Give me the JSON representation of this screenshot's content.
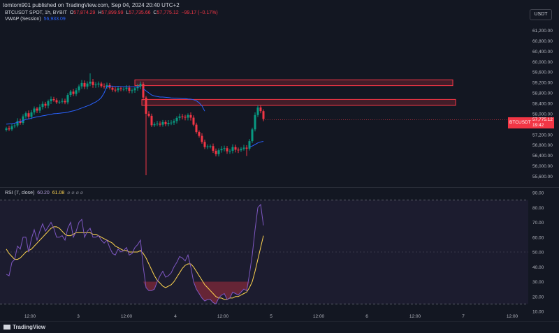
{
  "header": {
    "publisher_line": "tomtom901 published on TradingView.com, Sep 04, 2024 20:40 UTC+2",
    "symbol": "BTCUSDT SPOT, 1h, BYBIT",
    "ohlc": {
      "o_label": "O",
      "o": "57,874.29",
      "h_label": "H",
      "h": "57,899.99",
      "l_label": "L",
      "l": "57,735.66",
      "c_label": "C",
      "c": "57,775.12",
      "change": "−99.17 (−0.17%)"
    },
    "vwap_label": "VWAP (Session)",
    "vwap_value": "56,933.09",
    "rsi_label": "RSI (7, close)",
    "rsi_value": "60.20",
    "rsi_ma_value": "61.08",
    "rsi_extra": "⌀ ⌀ ⌀ ⌀",
    "currency_button": "USDT"
  },
  "price_tag": {
    "name": "BTCUSDT",
    "value": "57,775.12",
    "countdown": "19:42"
  },
  "footer": {
    "brand": "TradingView"
  },
  "colors": {
    "bg": "#131722",
    "up": "#089981",
    "down": "#f23645",
    "vwap": "#2962ff",
    "rsi": "#7e57c2",
    "rsi_ma": "#ffd54f",
    "zone": "#f23645"
  },
  "chart_data": [
    {
      "type": "candlestick",
      "title": "BTCUSDT SPOT, 1h, BYBIT",
      "ylim": [
        55400,
        61400
      ],
      "y_ticks": [
        "61,200.00",
        "60,800.00",
        "60,400.00",
        "60,000.00",
        "59,600.00",
        "59,200.00",
        "58,800.00",
        "58,400.00",
        "58,000.00",
        "57,600.00",
        "57,200.00",
        "56,800.00",
        "56,400.00",
        "56,000.00",
        "55,600.00"
      ],
      "x_ticks": [
        "12:00",
        "3",
        "12:00",
        "4",
        "12:00",
        "5",
        "12:00",
        "6",
        "12:00",
        "7",
        "12:00"
      ],
      "close": [
        57440,
        57400,
        57520,
        57550,
        57720,
        57650,
        57900,
        58020,
        57880,
        58050,
        58200,
        58120,
        58260,
        58380,
        58310,
        58480,
        58560,
        58520,
        58440,
        58460,
        58490,
        58440,
        58720,
        58850,
        58760,
        58900,
        59050,
        59180,
        59040,
        59160,
        59230,
        59100,
        59120,
        59160,
        59060,
        59030,
        59100,
        59000,
        58920,
        58900,
        58980,
        58950,
        58950,
        59000,
        58880,
        58900,
        58980,
        59050,
        59150,
        58620,
        58000,
        57920,
        57560,
        57600,
        57620,
        57580,
        57680,
        57600,
        57650,
        57660,
        57720,
        57840,
        57900,
        57880,
        57850,
        57950,
        57850,
        57580,
        57300,
        57150,
        56920,
        56720,
        56750,
        56760,
        56580,
        56450,
        56600,
        56650,
        56680,
        56560,
        56580,
        56720,
        56620,
        56600,
        56650,
        56700,
        56660,
        56950,
        57400,
        57950,
        58240,
        58100,
        57800
      ],
      "vwap": [
        57600,
        57610,
        57620,
        57640,
        57670,
        57700,
        57740,
        57780,
        57800,
        57830,
        57860,
        57880,
        57900,
        57920,
        57940,
        57960,
        57980,
        58000,
        58010,
        58020,
        58030,
        58040,
        58060,
        58090,
        58110,
        58140,
        58180,
        58220,
        58260,
        58300,
        58340,
        58400,
        58450,
        58520,
        58620,
        58800,
        59050,
        59060,
        59060,
        59050,
        59050,
        59040,
        59040,
        59040,
        59030,
        59030,
        59030,
        59030,
        59040,
        58960,
        58880,
        58800,
        58720,
        58680,
        58660,
        58640,
        58640,
        58630,
        58620,
        58610,
        58600,
        58600,
        58590,
        58580,
        58580,
        58570,
        58560,
        58540,
        58500,
        58420,
        58300,
        58100,
        57800,
        57450,
        57150,
        57000,
        56900,
        56850,
        56800,
        56760,
        56740,
        56720,
        56710,
        56700,
        56700,
        56700,
        56700,
        56720,
        56760,
        56820,
        56880,
        56920,
        56940
      ],
      "vwap_segments": [
        [
          0,
          48
        ],
        [
          49,
          71
        ],
        [
          87,
          92
        ]
      ],
      "zones": [
        {
          "top": 59300,
          "bottom": 59080,
          "label": ""
        },
        {
          "top": 58550,
          "bottom": 58320,
          "label": ""
        }
      ],
      "last_price": 57775.12
    },
    {
      "type": "line",
      "title": "RSI (7, close)",
      "ylim": [
        10,
        90
      ],
      "y_ticks": [
        "90.00",
        "80.00",
        "70.00",
        "60.00",
        "50.00",
        "40.00",
        "30.00",
        "20.00",
        "10.00"
      ],
      "bands": {
        "upper": 85,
        "lower": 15
      },
      "series": [
        {
          "name": "RSI",
          "values": [
            35,
            34,
            43,
            45,
            54,
            52,
            60,
            60,
            50,
            59,
            65,
            58,
            64,
            69,
            64,
            67,
            70,
            66,
            60,
            60,
            61,
            58,
            66,
            70,
            60,
            64,
            70,
            72,
            60,
            64,
            66,
            60,
            60,
            61,
            58,
            56,
            58,
            53,
            49,
            48,
            52,
            50,
            51,
            53,
            48,
            49,
            53,
            55,
            58,
            40,
            26,
            24,
            24,
            25,
            30,
            34,
            37,
            33,
            34,
            36,
            40,
            43,
            47,
            46,
            44,
            48,
            40,
            30,
            25,
            22,
            19,
            17,
            18,
            18,
            16,
            15,
            19,
            21,
            22,
            18,
            19,
            23,
            22,
            21,
            23,
            25,
            24,
            35,
            48,
            65,
            80,
            82,
            68
          ]
        },
        {
          "name": "RSI MA",
          "values": [
            52,
            49,
            47,
            45,
            45,
            46,
            48,
            50,
            51,
            52,
            54,
            56,
            58,
            60,
            62,
            64,
            66,
            67,
            67,
            66,
            64,
            62,
            61,
            61,
            62,
            63,
            63,
            63,
            63,
            63,
            63,
            62,
            62,
            61,
            60,
            59,
            58,
            57,
            56,
            54,
            53,
            52,
            51,
            51,
            50,
            50,
            50,
            50,
            51,
            49,
            46,
            42,
            38,
            34,
            31,
            29,
            27,
            26,
            27,
            28,
            30,
            33,
            36,
            39,
            41,
            42,
            42,
            40,
            37,
            34,
            31,
            28,
            26,
            24,
            22,
            20,
            19,
            19,
            18,
            18,
            19,
            19,
            20,
            20,
            21,
            22,
            23,
            26,
            30,
            37,
            45,
            53,
            61
          ]
        }
      ]
    }
  ]
}
